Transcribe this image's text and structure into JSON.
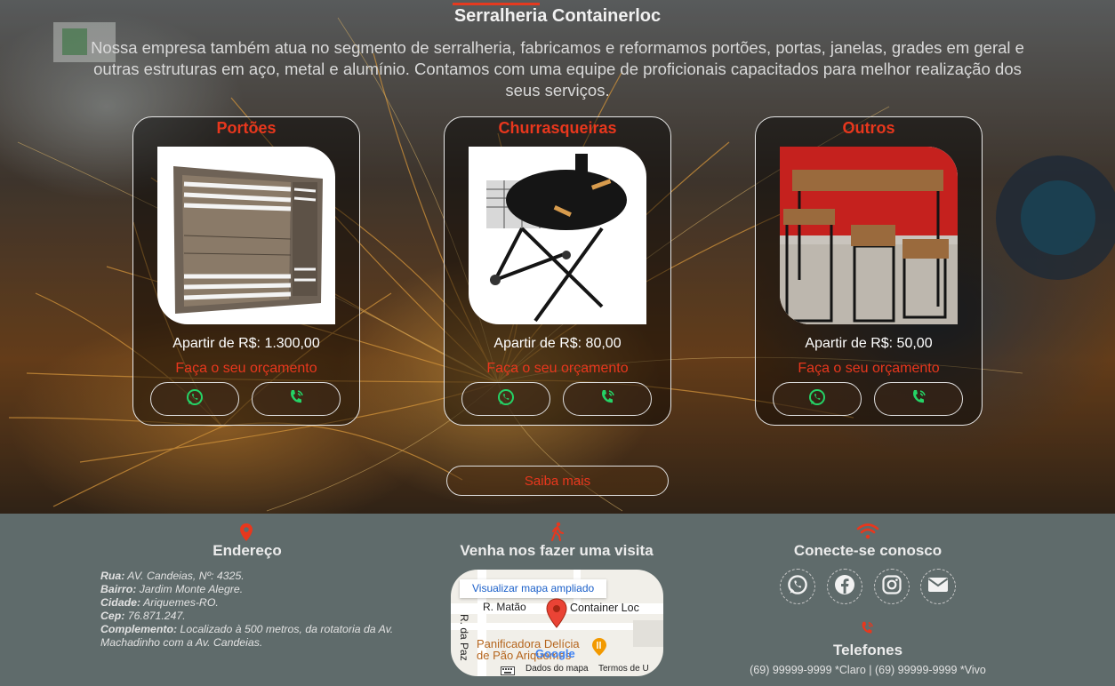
{
  "hero": {
    "title": "Serralheria Containerloc",
    "description": "Nossa empresa também atua no segmento de serralheria, fabricamos e reformamos portões, portas, janelas, grades em geral e outras estruturas em aço, metal e alumínio. Contamos com uma equipe de proficionais capacitados para melhor realização dos seus serviços."
  },
  "cards": [
    {
      "title": "Portões",
      "price": "Apartir de R$: 1.300,00",
      "quote": "Faça o seu orçamento",
      "image": "gate-image"
    },
    {
      "title": "Churrasqueiras",
      "price": "Apartir de R$: 80,00",
      "quote": "Faça o seu orçamento",
      "image": "barbecue-grill-image"
    },
    {
      "title": "Outros",
      "price": "Apartir de R$: 50,00",
      "quote": "Faça o seu orçamento",
      "image": "table-and-stools-image"
    }
  ],
  "buttons": {
    "saiba_mais": "Saiba mais",
    "whatsapp_icon": "whatsapp-icon",
    "phone_icon": "phone-icon"
  },
  "footer": {
    "address": {
      "heading": "Endereço",
      "rua_label": "Rua:",
      "rua": "AV. Candeias, Nº: 4325.",
      "bairro_label": "Bairro:",
      "bairro": "Jardim Monte Alegre.",
      "cidade_label": "Cidade:",
      "cidade": "Ariquemes-RO.",
      "cep_label": "Cep:",
      "cep": "76.871.247.",
      "complemento_label": "Complemento:",
      "complemento": "Localizado à 500 metros, da rotatoria da Av. Machadinho com a Av. Candeias."
    },
    "visit": {
      "heading": "Venha nos fazer uma visita",
      "map_button": "Visualizar mapa ampliado",
      "street_1": "R. Matão",
      "street_2": "R. da Paz",
      "place_marker": "Container Loc",
      "poi": "Panificadora Delícia de Pão Ariquemes",
      "brand": "Google",
      "data_label": "Dados do mapa",
      "terms_label": "Termos de U"
    },
    "connect": {
      "heading": "Conecte-se conosco",
      "icons": [
        "whatsapp-icon",
        "facebook-icon",
        "instagram-icon",
        "email-icon"
      ]
    },
    "phones": {
      "heading": "Telefones",
      "text": "(69) 99999-9999 *Claro | (69) 99999-9999 *Vivo"
    }
  },
  "colors": {
    "accent": "#e8371d",
    "whatsapp_green": "#25d366",
    "footer_bg": "#5f6b6b"
  }
}
